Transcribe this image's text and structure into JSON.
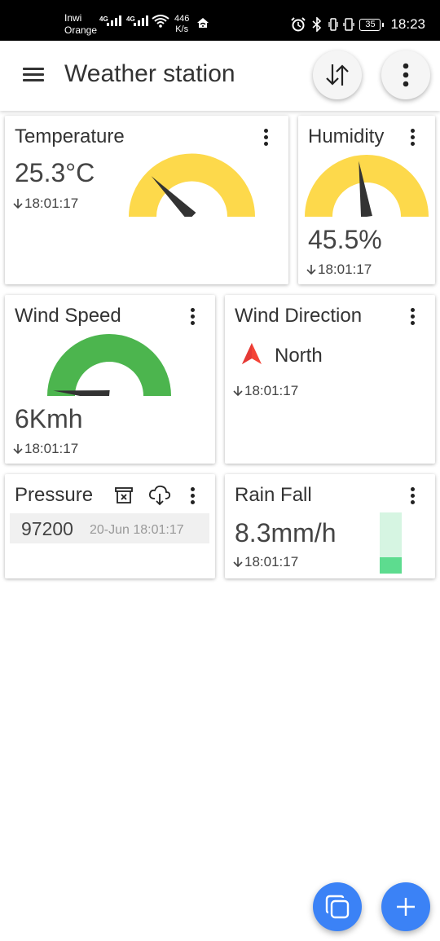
{
  "status_bar": {
    "carrier_1": "Inwi",
    "carrier_2": "Orange",
    "network_1": "4G",
    "network_2": "4G",
    "speed_value": "446",
    "speed_unit": "K/s",
    "battery": "35",
    "time": "18:23"
  },
  "app_bar": {
    "title": "Weather station"
  },
  "colors": {
    "gauge_yellow": "#fdd94b",
    "gauge_green": "#4cb54e",
    "needle": "#333333",
    "fab_blue": "#3b82f6",
    "direction_red": "#f44336",
    "rain_light": "#d6f5e2",
    "rain_fill": "#5ddc8f"
  },
  "cards": {
    "temperature": {
      "title": "Temperature",
      "value": "25.3°C",
      "time": "18:01:17",
      "gauge_fraction": 0.25
    },
    "humidity": {
      "title": "Humidity",
      "value": "45.5%",
      "time": "18:01:17",
      "gauge_fraction": 0.455
    },
    "wind_speed": {
      "title": "Wind Speed",
      "value": "6Kmh",
      "time": "18:01:17",
      "gauge_fraction": 0.03
    },
    "wind_direction": {
      "title": "Wind Direction",
      "direction": "North",
      "time": "18:01:17"
    },
    "pressure": {
      "title": "Pressure",
      "value": "97200",
      "date": "20-Jun 18:01:17"
    },
    "rain_fall": {
      "title": "Rain Fall",
      "value": "8.3mm/h",
      "time": "18:01:17",
      "level_fraction": 0.27
    }
  }
}
